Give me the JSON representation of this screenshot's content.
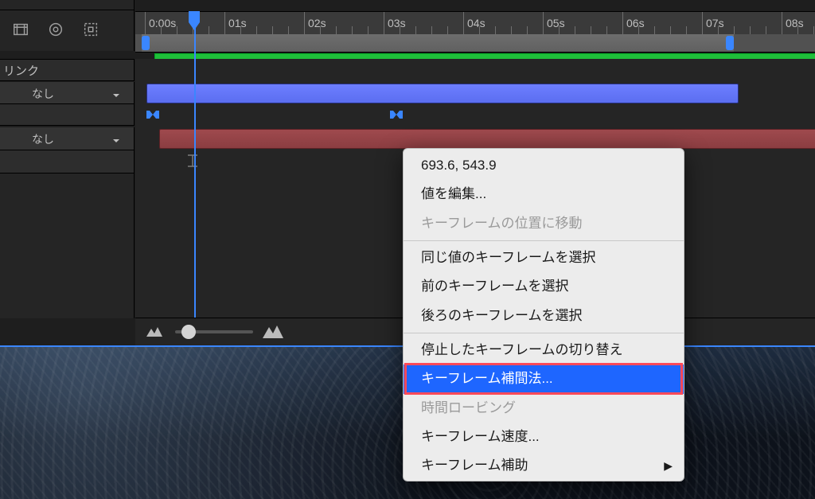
{
  "timeline": {
    "parent_header": "リンク",
    "dropdown_none": "なし",
    "ticks": [
      "0:00s",
      "01s",
      "02s",
      "03s",
      "04s",
      "05s",
      "06s",
      "07s",
      "08s"
    ],
    "playhead_seconds": 0.62,
    "work_area_end_seconds": 7.35,
    "comp_green_end_seconds": 8.8,
    "layer1_end_seconds": 7.35,
    "keyframe1_seconds": 0.1,
    "keyframe2_seconds": 3.15,
    "ibeam_seconds": 0.6,
    "layer2_start_seconds": 0.18,
    "layer2_end_seconds": 8.8
  },
  "context_menu": {
    "value_display": "693.6, 543.9",
    "edit_value": "値を編集...",
    "goto_keyframe_time": "キーフレームの位置に移動",
    "select_equal": "同じ値のキーフレームを選択",
    "select_prev": "前のキーフレームを選択",
    "select_next": "後ろのキーフレームを選択",
    "toggle_hold": "停止したキーフレームの切り替え",
    "interpolation": "キーフレーム補間法...",
    "rove_across": "時間ロービング",
    "velocity": "キーフレーム速度...",
    "assistant": "キーフレーム補助"
  }
}
